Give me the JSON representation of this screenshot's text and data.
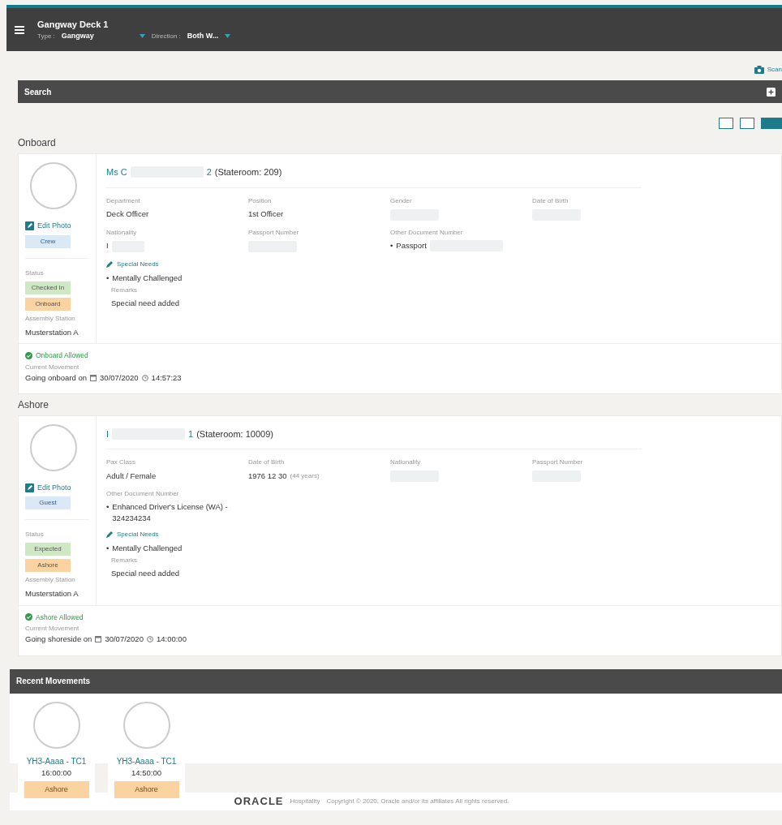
{
  "header": {
    "title": "Gangway Deck 1",
    "filters": [
      {
        "label": "Type :",
        "value": "Gangway"
      },
      {
        "label": "Direction :",
        "value": "Both W..."
      }
    ]
  },
  "scan_button": "Scan",
  "search_panel": {
    "title": "Search"
  },
  "view_toggle": [
    {
      "selected": false
    },
    {
      "selected": false
    },
    {
      "selected": true
    }
  ],
  "sections": [
    {
      "heading": "Onboard",
      "person": {
        "name_prefix": "Ms C",
        "name_suffix": "2",
        "stateroom": "(Stateroom: 209)",
        "edit_photo": "Edit Photo",
        "type_badge": "Crew",
        "status_label": "Status",
        "statuses": [
          {
            "text": "Checked In",
            "color": "#cfe8c4"
          },
          {
            "text": "Onboard",
            "color": "#fbd3a0"
          }
        ],
        "assembly_label": "Assembly Station",
        "assembly": "Musterstation A",
        "fields": [
          {
            "kind": "text",
            "label": "Department",
            "value": "Deck Officer"
          },
          {
            "kind": "text",
            "label": "Position",
            "value": "1st Officer"
          },
          {
            "kind": "text",
            "label": "Gender",
            "redacted": true
          },
          {
            "kind": "text",
            "label": "Date of Birth",
            "redacted": true
          },
          {
            "kind": "text",
            "label": "Nationality",
            "value": "I",
            "redacted": true
          },
          {
            "kind": "text",
            "label": "Passport Number",
            "redacted": true
          },
          {
            "kind": "list",
            "label": "Other Document Number",
            "marker": "•",
            "items": [
              {
                "text": "Passport",
                "redacted": true
              }
            ]
          }
        ],
        "special_needs": {
          "link": "Special Needs",
          "marker": "•",
          "items": [
            "Mentally Challenged"
          ],
          "remarks_label": "Remarks",
          "remarks": "Special need added"
        },
        "allowance": "Onboard Allowed",
        "movement_label": "Current Movement",
        "movement_text": "Going onboard on",
        "date": "30/07/2020",
        "time": "14:57:23"
      }
    },
    {
      "heading": "Ashore",
      "person": {
        "name_prefix": "I",
        "name_suffix": "1",
        "stateroom": "(Stateroom: 10009)",
        "edit_photo": "Edit Photo",
        "type_badge": "Guest",
        "status_label": "Status",
        "statuses": [
          {
            "text": "Expected",
            "color": "#cfe8c4"
          },
          {
            "text": "Ashore",
            "color": "#fbd3a0"
          }
        ],
        "assembly_label": "Assembly Station",
        "assembly": "Musterstation A",
        "fields": [
          {
            "kind": "text",
            "label": "Pax Class",
            "value": "Adult / Female"
          },
          {
            "kind": "text",
            "label": "Date of Birth",
            "value": "1976 12 30",
            "note": "(44 years)"
          },
          {
            "kind": "text",
            "label": "Nationality",
            "redacted": true
          },
          {
            "kind": "text",
            "label": "Passport Number",
            "redacted": true
          },
          {
            "kind": "list",
            "label": "Other Document Number",
            "marker": "•",
            "items": [
              {
                "text": "Enhanced Driver's License (WA) - 324234234"
              }
            ]
          }
        ],
        "special_needs": {
          "link": "Special Needs",
          "marker": "•",
          "items": [
            "Mentally Challenged"
          ],
          "remarks_label": "Remarks",
          "remarks": "Special need added"
        },
        "allowance": "Ashore Allowed",
        "movement_label": "Current Movement",
        "movement_text": "Going shoreside on",
        "date": "30/07/2020",
        "time": "14:00:00"
      }
    }
  ],
  "recent_movements": {
    "title": "Recent Movements",
    "items": [
      {
        "name": "YH3-Aaaa - TC1",
        "time": "16:00:00",
        "status": "Ashore"
      },
      {
        "name": "YH3-Aaaa - TC1",
        "time": "14:50:00",
        "status": "Ashore"
      }
    ]
  },
  "footer": {
    "logo": "ORACLE",
    "product": "Hospitality",
    "copyright": "Copyright © 2020, Oracle and/or its affiliates All rights reserved."
  }
}
